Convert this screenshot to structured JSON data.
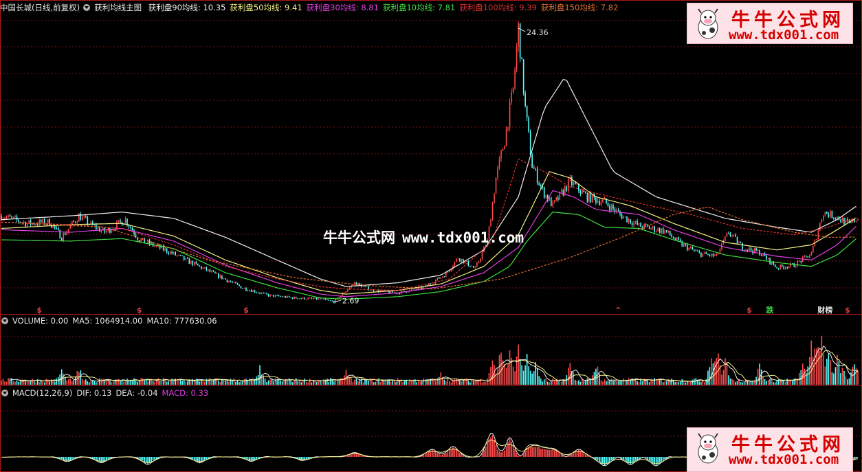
{
  "header": {
    "stock": "中国长城(日线,前复权)",
    "indicator": "获利均线主图",
    "series": [
      {
        "label": "获利盘90均线: 10.35",
        "color": "#f0f0f0"
      },
      {
        "label": "获利盘50均线: 9.41",
        "color": "#f5f088"
      },
      {
        "label": "获利盘30均线: 8.81",
        "color": "#e040e0"
      },
      {
        "label": "获利盘10均线: 7.81",
        "color": "#40e040"
      },
      {
        "label": "获利盘100均线: 9.39",
        "color": "#e03030"
      },
      {
        "label": "获利盘150均线: 7.82",
        "color": "#e07030"
      }
    ]
  },
  "volume_header": {
    "items": [
      {
        "label": "VOLUME: 0.00",
        "color": "#e8e8e8"
      },
      {
        "label": "MA5: 1064914.00",
        "color": "#e8e8e8"
      },
      {
        "label": "MA10: 777630.06",
        "color": "#e8e8e8"
      }
    ]
  },
  "macd_header": {
    "items": [
      {
        "label": "MACD(12,26,9)",
        "color": "#e8e8e8"
      },
      {
        "label": "DIF: 0.13",
        "color": "#e8e8e8"
      },
      {
        "label": "DEA: -0.04",
        "color": "#e8e8e8"
      },
      {
        "label": "MACD: 0.33",
        "color": "#e040e0"
      }
    ]
  },
  "logo": {
    "title": "牛牛公式网",
    "url": "www.tdx001.com"
  },
  "watermark": {
    "title": "牛牛公式网",
    "url": "www.tdx001.com"
  },
  "signals": [
    {
      "text": "$",
      "bar": 22,
      "color": "#e04040"
    },
    {
      "text": "$",
      "bar": 80,
      "color": "#e04040"
    },
    {
      "text": "$",
      "bar": 142,
      "color": "#e04040"
    },
    {
      "text": "^",
      "bar": 358,
      "color": "#e04040"
    },
    {
      "text": "$",
      "bar": 434,
      "color": "#e04040"
    },
    {
      "text": "跌",
      "bar": 446,
      "color": "#40e040"
    },
    {
      "text": "财榜",
      "bar": 478,
      "color": "#e8e8e8"
    },
    {
      "text": "$",
      "bar": 491,
      "color": "#e04040"
    }
  ],
  "chart_data": {
    "type": "line",
    "price_range": [
      2.0,
      25.5
    ],
    "annotations": [
      {
        "text": "24.36",
        "bar": 300,
        "value": 24.36
      },
      {
        "text": "2.69",
        "bar": 193,
        "value": 2.69
      }
    ],
    "price_anchors": [
      [
        0,
        9.5
      ],
      [
        15,
        8.9
      ],
      [
        28,
        9.0
      ],
      [
        35,
        7.8
      ],
      [
        45,
        9.5
      ],
      [
        52,
        8.8
      ],
      [
        60,
        8.2
      ],
      [
        72,
        9.2
      ],
      [
        80,
        7.6
      ],
      [
        95,
        6.8
      ],
      [
        110,
        5.8
      ],
      [
        125,
        4.8
      ],
      [
        140,
        3.8
      ],
      [
        155,
        3.2
      ],
      [
        170,
        3.0
      ],
      [
        185,
        2.9
      ],
      [
        193,
        2.69
      ],
      [
        205,
        4.2
      ],
      [
        215,
        3.6
      ],
      [
        230,
        3.4
      ],
      [
        245,
        3.8
      ],
      [
        258,
        4.9
      ],
      [
        265,
        6.2
      ],
      [
        275,
        5.3
      ],
      [
        282,
        7.5
      ],
      [
        287,
        12.5
      ],
      [
        292,
        15.5
      ],
      [
        297,
        19.5
      ],
      [
        300,
        24.36
      ],
      [
        304,
        18.0
      ],
      [
        308,
        13.5
      ],
      [
        314,
        11.5
      ],
      [
        320,
        10.3
      ],
      [
        330,
        12.2
      ],
      [
        340,
        11.0
      ],
      [
        350,
        10.6
      ],
      [
        360,
        9.5
      ],
      [
        370,
        8.7
      ],
      [
        385,
        8.3
      ],
      [
        395,
        7.2
      ],
      [
        405,
        6.5
      ],
      [
        415,
        6.3
      ],
      [
        422,
        8.2
      ],
      [
        430,
        7.0
      ],
      [
        440,
        6.6
      ],
      [
        450,
        5.4
      ],
      [
        460,
        5.6
      ],
      [
        470,
        6.5
      ],
      [
        477,
        9.8
      ],
      [
        485,
        9.4
      ],
      [
        492,
        8.8
      ],
      [
        497,
        9.4
      ]
    ],
    "ma_lines": [
      {
        "name": "获利盘90均线",
        "color": "#f0f0f0",
        "anchors": [
          [
            0,
            9.2
          ],
          [
            40,
            9.5
          ],
          [
            70,
            9.8
          ],
          [
            100,
            9.3
          ],
          [
            130,
            7.8
          ],
          [
            160,
            6.0
          ],
          [
            185,
            4.5
          ],
          [
            200,
            3.9
          ],
          [
            230,
            4.2
          ],
          [
            255,
            4.8
          ],
          [
            280,
            6.8
          ],
          [
            300,
            11.0
          ],
          [
            315,
            18.0
          ],
          [
            327,
            20.5
          ],
          [
            340,
            17.0
          ],
          [
            355,
            13.0
          ],
          [
            380,
            11.0
          ],
          [
            420,
            9.3
          ],
          [
            450,
            8.6
          ],
          [
            470,
            8.2
          ],
          [
            485,
            9.2
          ],
          [
            497,
            10.35
          ]
        ]
      },
      {
        "name": "获利盘50均线",
        "color": "#f5f088",
        "anchors": [
          [
            0,
            8.5
          ],
          [
            40,
            8.8
          ],
          [
            70,
            8.9
          ],
          [
            100,
            7.9
          ],
          [
            130,
            6.0
          ],
          [
            160,
            4.6
          ],
          [
            185,
            3.6
          ],
          [
            200,
            3.3
          ],
          [
            230,
            3.6
          ],
          [
            255,
            4.1
          ],
          [
            280,
            5.5
          ],
          [
            300,
            8.0
          ],
          [
            318,
            13.0
          ],
          [
            330,
            12.5
          ],
          [
            345,
            11.0
          ],
          [
            365,
            10.3
          ],
          [
            390,
            8.9
          ],
          [
            420,
            7.4
          ],
          [
            450,
            6.8
          ],
          [
            470,
            7.2
          ],
          [
            485,
            8.4
          ],
          [
            497,
            9.41
          ]
        ]
      },
      {
        "name": "获利盘30均线",
        "color": "#e040e0",
        "anchors": [
          [
            0,
            8.4
          ],
          [
            40,
            8.2
          ],
          [
            70,
            8.5
          ],
          [
            100,
            7.5
          ],
          [
            130,
            5.6
          ],
          [
            160,
            4.2
          ],
          [
            185,
            3.3
          ],
          [
            200,
            3.1
          ],
          [
            230,
            3.4
          ],
          [
            255,
            3.9
          ],
          [
            280,
            5.0
          ],
          [
            300,
            7.0
          ],
          [
            320,
            11.5
          ],
          [
            332,
            11.0
          ],
          [
            345,
            10.0
          ],
          [
            370,
            9.6
          ],
          [
            390,
            8.4
          ],
          [
            420,
            7.0
          ],
          [
            450,
            6.3
          ],
          [
            470,
            6.0
          ],
          [
            485,
            7.2
          ],
          [
            497,
            8.81
          ]
        ]
      },
      {
        "name": "获利盘10均线",
        "color": "#40e040",
        "anchors": [
          [
            0,
            7.6
          ],
          [
            40,
            7.5
          ],
          [
            70,
            7.7
          ],
          [
            100,
            6.9
          ],
          [
            130,
            5.0
          ],
          [
            160,
            3.8
          ],
          [
            185,
            3.0
          ],
          [
            200,
            2.9
          ],
          [
            230,
            3.1
          ],
          [
            255,
            3.5
          ],
          [
            280,
            4.3
          ],
          [
            295,
            5.5
          ],
          [
            305,
            7.5
          ],
          [
            320,
            9.8
          ],
          [
            335,
            9.6
          ],
          [
            350,
            8.6
          ],
          [
            370,
            8.5
          ],
          [
            390,
            7.6
          ],
          [
            420,
            6.4
          ],
          [
            450,
            5.8
          ],
          [
            470,
            5.5
          ],
          [
            485,
            6.4
          ],
          [
            497,
            7.81
          ]
        ]
      },
      {
        "name": "获利盘100均线",
        "color": "#e03030",
        "dashed": true,
        "anchors": [
          [
            0,
            9.0
          ],
          [
            40,
            8.8
          ],
          [
            70,
            8.5
          ],
          [
            100,
            7.2
          ],
          [
            130,
            5.5
          ],
          [
            160,
            4.5
          ],
          [
            185,
            3.9
          ],
          [
            200,
            3.7
          ],
          [
            230,
            3.6
          ],
          [
            260,
            4.5
          ],
          [
            285,
            7.5
          ],
          [
            300,
            14.0
          ],
          [
            315,
            13.0
          ],
          [
            330,
            11.8
          ],
          [
            360,
            10.8
          ],
          [
            400,
            9.6
          ],
          [
            430,
            8.5
          ],
          [
            460,
            8.0
          ],
          [
            480,
            8.6
          ],
          [
            497,
            9.39
          ]
        ]
      },
      {
        "name": "获利盘150均线",
        "color": "#e07030",
        "dashed": true,
        "anchors": [
          [
            0,
            9.0
          ],
          [
            60,
            8.6
          ],
          [
            120,
            6.0
          ],
          [
            170,
            4.6
          ],
          [
            210,
            4.0
          ],
          [
            250,
            3.7
          ],
          [
            290,
            4.5
          ],
          [
            330,
            6.2
          ],
          [
            360,
            7.8
          ],
          [
            390,
            9.6
          ],
          [
            410,
            10.2
          ],
          [
            430,
            9.2
          ],
          [
            460,
            8.2
          ],
          [
            480,
            7.8
          ],
          [
            497,
            7.82
          ]
        ]
      }
    ],
    "volume_events": [
      [
        35,
        0.3
      ],
      [
        45,
        0.35
      ],
      [
        150,
        0.35
      ],
      [
        200,
        0.28
      ],
      [
        255,
        0.25
      ],
      [
        285,
        0.6
      ],
      [
        290,
        0.75
      ],
      [
        295,
        0.65
      ],
      [
        300,
        0.8
      ],
      [
        305,
        0.55
      ],
      [
        310,
        0.45
      ],
      [
        330,
        0.5
      ],
      [
        345,
        0.45
      ],
      [
        412,
        0.6
      ],
      [
        415,
        0.75
      ],
      [
        420,
        0.55
      ],
      [
        440,
        0.4
      ],
      [
        465,
        0.45
      ],
      [
        470,
        0.85
      ],
      [
        473,
        1.0
      ],
      [
        476,
        0.9
      ],
      [
        480,
        0.7
      ],
      [
        485,
        0.6
      ],
      [
        488,
        0.45
      ],
      [
        495,
        0.55
      ]
    ],
    "macd_events": [
      [
        38,
        -0.15
      ],
      [
        58,
        -0.2
      ],
      [
        85,
        -0.25
      ],
      [
        115,
        -0.2
      ],
      [
        145,
        -0.15
      ],
      [
        175,
        -0.12
      ],
      [
        205,
        0.15
      ],
      [
        250,
        0.25
      ],
      [
        262,
        0.35
      ],
      [
        285,
        0.9
      ],
      [
        290,
        -0.35
      ],
      [
        295,
        0.85
      ],
      [
        300,
        -0.3
      ],
      [
        305,
        0.4
      ],
      [
        312,
        0.35
      ],
      [
        320,
        0.3
      ],
      [
        335,
        0.25
      ],
      [
        350,
        -0.3
      ],
      [
        365,
        -0.25
      ],
      [
        380,
        -0.3
      ],
      [
        410,
        0.45
      ],
      [
        420,
        -0.3
      ],
      [
        440,
        0.2
      ],
      [
        455,
        -0.3
      ],
      [
        472,
        0.5
      ],
      [
        480,
        0.45
      ],
      [
        490,
        -0.2
      ]
    ]
  }
}
